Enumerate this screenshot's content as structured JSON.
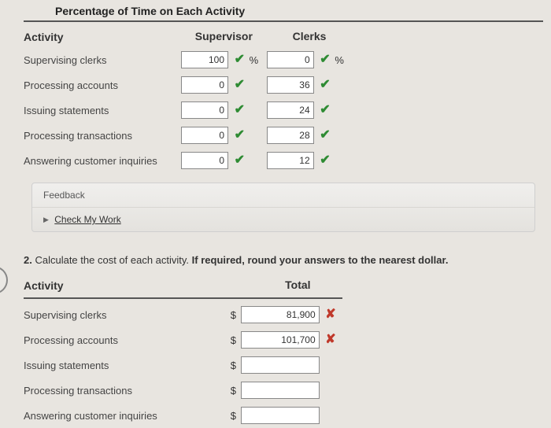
{
  "section1": {
    "title": "Percentage of Time on Each Activity",
    "headers": {
      "activity": "Activity",
      "supervisor": "Supervisor",
      "clerks": "Clerks"
    },
    "unit": "%",
    "rows": [
      {
        "label": "Supervising clerks",
        "sup": "100",
        "clk": "0",
        "showUnitSup": true,
        "showUnitClk": true
      },
      {
        "label": "Processing accounts",
        "sup": "0",
        "clk": "36",
        "showUnitSup": false,
        "showUnitClk": false
      },
      {
        "label": "Issuing statements",
        "sup": "0",
        "clk": "24",
        "showUnitSup": false,
        "showUnitClk": false
      },
      {
        "label": "Processing transactions",
        "sup": "0",
        "clk": "28",
        "showUnitSup": false,
        "showUnitClk": false
      },
      {
        "label": "Answering customer inquiries",
        "sup": "0",
        "clk": "12",
        "showUnitSup": false,
        "showUnitClk": false
      }
    ]
  },
  "feedback": {
    "label": "Feedback",
    "link": "Check My Work"
  },
  "section2": {
    "num": "2.",
    "prompt_a": "Calculate the cost of each activity. ",
    "prompt_b": "If required, round your answers to the nearest dollar.",
    "headers": {
      "activity": "Activity",
      "total": "Total"
    },
    "currency": "$",
    "rows": [
      {
        "label": "Supervising clerks",
        "val": "81,900",
        "mark": "cross"
      },
      {
        "label": "Processing accounts",
        "val": "101,700",
        "mark": "cross"
      },
      {
        "label": "Issuing statements",
        "val": "",
        "mark": ""
      },
      {
        "label": "Processing transactions",
        "val": "",
        "mark": ""
      },
      {
        "label": "Answering customer inquiries",
        "val": "",
        "mark": ""
      }
    ]
  }
}
